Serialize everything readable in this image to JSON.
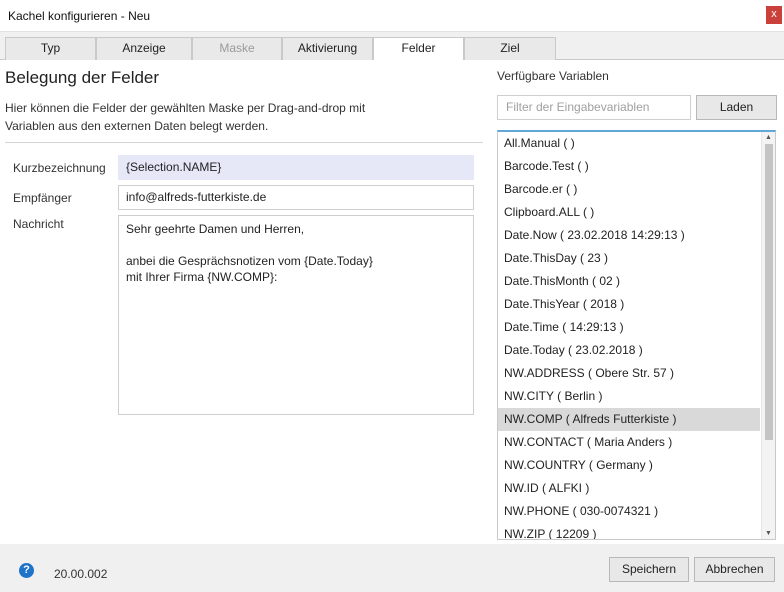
{
  "window": {
    "title": "Kachel konfigurieren - Neu",
    "close": "x"
  },
  "tabs": [
    {
      "label": "Typ",
      "state": "normal"
    },
    {
      "label": "Anzeige",
      "state": "normal"
    },
    {
      "label": "Maske",
      "state": "disabled"
    },
    {
      "label": "Aktivierung",
      "state": "normal"
    },
    {
      "label": "Felder",
      "state": "active"
    },
    {
      "label": "Ziel",
      "state": "normal"
    }
  ],
  "main": {
    "heading": "Belegung der Felder",
    "description": "Hier können die Felder der gewählten Maske per Drag-and-drop mit Variablen aus den externen Daten belegt werden.",
    "fields": {
      "kurz": {
        "label": "Kurzbezeichnung",
        "value": "{Selection.NAME}"
      },
      "empf": {
        "label": "Empfänger",
        "value": "info@alfreds-futterkiste.de"
      },
      "nachricht": {
        "label": "Nachricht",
        "value": "Sehr geehrte Damen und Herren,\n\nanbei die Gesprächsnotizen vom {Date.Today}\nmit Ihrer Firma {NW.COMP}:"
      }
    }
  },
  "variables": {
    "heading": "Verfügbare Variablen",
    "filter_placeholder": "Filter der Eingabevariablen",
    "load_label": "Laden",
    "items": [
      "All.Manual (  )",
      "Barcode.Test (  )",
      "Barcode.er (  )",
      "Clipboard.ALL (  )",
      "Date.Now ( 23.02.2018 14:29:13 )",
      "Date.ThisDay ( 23 )",
      "Date.ThisMonth ( 02 )",
      "Date.ThisYear ( 2018 )",
      "Date.Time ( 14:29:13 )",
      "Date.Today ( 23.02.2018 )",
      "NW.ADDRESS ( Obere Str. 57 )",
      "NW.CITY ( Berlin )",
      "NW.COMP ( Alfreds Futterkiste )",
      "NW.CONTACT ( Maria Anders )",
      "NW.COUNTRY ( Germany )",
      "NW.ID ( ALFKI )",
      "NW.PHONE ( 030-0074321 )",
      "NW.ZIP ( 12209 )"
    ],
    "selected_index": 12
  },
  "footer": {
    "help": "?",
    "version": "20.00.002",
    "save_label": "Speichern",
    "cancel_label": "Abbrechen"
  }
}
